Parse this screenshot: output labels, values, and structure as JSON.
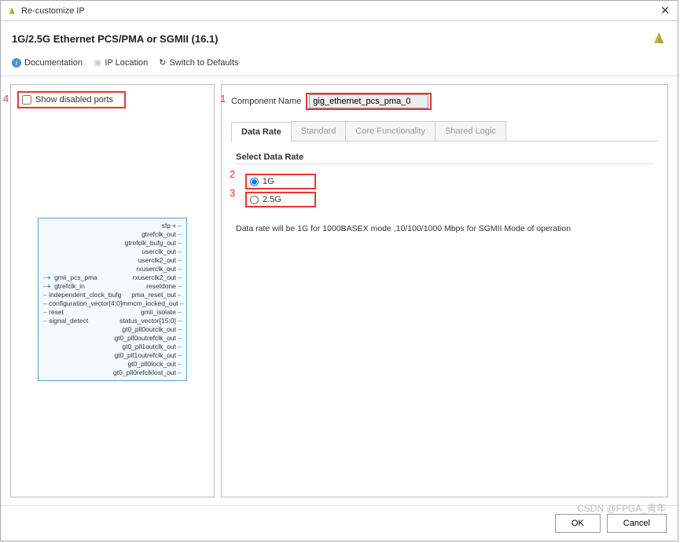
{
  "window": {
    "title": "Re-customize IP"
  },
  "header": {
    "title": "1G/2.5G Ethernet PCS/PMA or SGMII (16.1)"
  },
  "toolbar": {
    "documentation": "Documentation",
    "ip_location": "IP Location",
    "switch_defaults": "Switch to Defaults"
  },
  "left": {
    "show_disabled_ports": "Show disabled ports",
    "block_left": [
      "gmii_pcs_pma",
      "gtrefclk_in",
      "independent_clock_bufg",
      "configuration_vector[4:0]",
      "reset",
      "signal_detect"
    ],
    "block_right": [
      "sfp",
      "gtrefclk_out",
      "gtrefclk_bufg_out",
      "userclk_out",
      "userclk2_out",
      "rxuserclk_out",
      "rxuserclk2_out",
      "resetdone",
      "pma_reset_out",
      "mmcm_locked_out",
      "gmii_isolate",
      "status_vector[15:0]",
      "gt0_pll0outclk_out",
      "gt0_pll0outrefclk_out",
      "gt0_pll1outclk_out",
      "gt0_pll1outrefclk_out",
      "gt0_pll0lock_out",
      "gt0_pll0refclklost_out"
    ]
  },
  "right": {
    "component_name_label": "Component Name",
    "component_name_value": "gig_ethernet_pcs_pma_0",
    "tabs": {
      "data_rate": "Data Rate",
      "standard": "Standard",
      "core_func": "Core Functionality",
      "shared_logic": "Shared Logic"
    },
    "section_title": "Select Data Rate",
    "opt_1g": "1G",
    "opt_25g": "2.5G",
    "desc": "Data rate will be 1G for 1000BASEX mode ,10/100/1000 Mbps for SGMII Mode of operation"
  },
  "footer": {
    "ok": "OK",
    "cancel": "Cancel"
  },
  "annot": {
    "a1": "1",
    "a2": "2",
    "a3": "3",
    "a4": "4"
  },
  "watermark": "CSDN @FPGA_青年"
}
